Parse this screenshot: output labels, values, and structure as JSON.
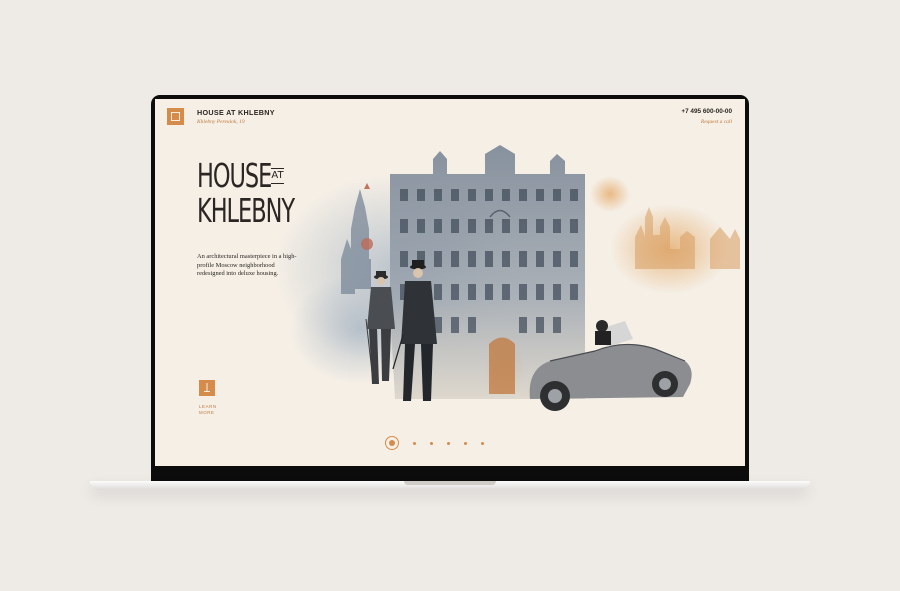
{
  "header": {
    "brand_title": "HOUSE AT KHLEBNY",
    "address": "Khlebny Pereulok, 19",
    "phone": "+7 495 600-00-00",
    "request_call": "Request a call"
  },
  "hero": {
    "title_word_1": "HOUSE",
    "title_at": "AT",
    "title_word_2": "KHLEBNY",
    "description": "An architectural masterpiece in a high-profile Moscow neighborhood redesigned into deluxe housing."
  },
  "learn_more": {
    "label": "LEARN MORE",
    "icon": "arrow-down-icon"
  },
  "pagination": {
    "total": 6,
    "active_index": 0
  },
  "colors": {
    "accent": "#d58c4a",
    "text": "#2b2623",
    "screen_bg": "#f5efe6",
    "page_bg": "#eeeae6"
  }
}
